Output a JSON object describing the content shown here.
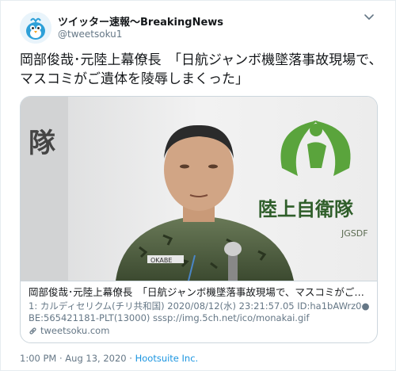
{
  "tweet": {
    "display_name": "ツイッター速報〜BreakingNews",
    "handle": "@tweetsoku1",
    "text": "岡部俊哉･元陸上幕僚長　「日航ジャンボ機墜落事故現場で、マスコミがご遺体を陵辱しまくった」",
    "caret_icon": "chevron-down-icon",
    "avatar_icon": "blue-bird-avatar"
  },
  "card": {
    "image_sign_text_left": "隊",
    "image_sign_text_right": "陸上自衛隊",
    "image_sign_text_small": "JGSDF",
    "image_badge": "OKABE",
    "title": "岡部俊哉･元陸上幕僚長　「日航ジャンボ機墜落事故現場で、マスコミがご遺体を陵辱し…",
    "description": "1: カルディセリクム(チリ共和国) 2020/08/12(水) 23:21:57.05 ID:ha1bAWrz0● BE:565421181-PLT(13000) sssp://img.5ch.net/ico/monakai.gif",
    "domain": "tweetsoku.com",
    "link_icon": "link-icon"
  },
  "footer": {
    "time": "1:00 PM · Aug 13, 2020 · ",
    "app": "Hootsuite Inc."
  },
  "colors": {
    "link": "#1b95e0",
    "secondary_text": "#657786",
    "border": "#ccd6dd",
    "sign_green": "#5aa43c"
  }
}
